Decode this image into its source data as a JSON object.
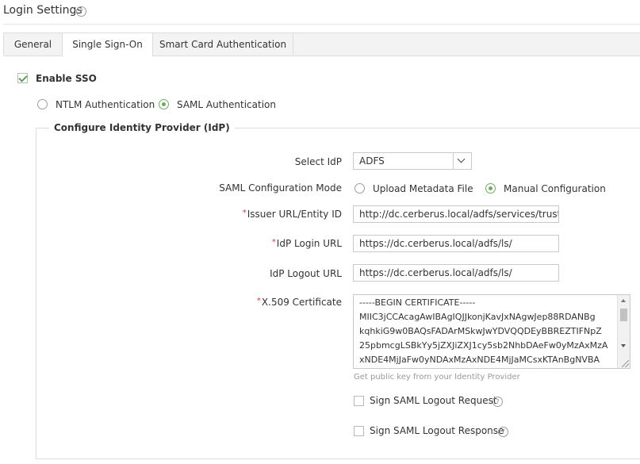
{
  "page": {
    "title": "Login Settings",
    "help_glyph": "?"
  },
  "tabs": [
    {
      "label": "General",
      "active": false
    },
    {
      "label": "Single Sign-On",
      "active": true
    },
    {
      "label": "Smart Card Authentication",
      "active": false
    }
  ],
  "sso": {
    "enable_label": "Enable SSO",
    "enabled": true,
    "auth_options": [
      {
        "label": "NTLM Authentication",
        "selected": false
      },
      {
        "label": "SAML Authentication",
        "selected": true
      }
    ]
  },
  "idp": {
    "section_title": "Configure Identity Provider (IdP)",
    "select_idp": {
      "label": "Select IdP",
      "value": "ADFS"
    },
    "config_mode": {
      "label": "SAML Configuration Mode",
      "options": [
        {
          "label": "Upload Metadata File",
          "selected": false
        },
        {
          "label": "Manual Configuration",
          "selected": true
        }
      ]
    },
    "issuer_url": {
      "label": "Issuer URL/Entity ID",
      "required": true,
      "value": "http://dc.cerberus.local/adfs/services/trust"
    },
    "login_url": {
      "label": "IdP Login URL",
      "required": true,
      "value": "https://dc.cerberus.local/adfs/ls/"
    },
    "logout_url": {
      "label": "IdP Logout URL",
      "required": false,
      "value": "https://dc.cerberus.local/adfs/ls/"
    },
    "certificate": {
      "label": "X.509 Certificate",
      "required": true,
      "lines": [
        "-----BEGIN CERTIFICATE-----",
        "MIIC3jCCAcagAwIBAgIQJJkonjKavJxNAgwJep88RDANBg",
        "kqhkiG9w0BAQsFADArMSkwJwYDVQQDEyBBREZTIFNpZ",
        "25pbmcgLSBkYy5jZXJiZXJ1cy5sb2NhbDAeFw0yMzAxMzA",
        "xNDE4MjJaFw0yNDAxMzAxNDE4MjJaMCsxKTAnBgNVBA"
      ],
      "hint": "Get public key from your Identity Provider"
    },
    "sign_logout_request": {
      "label": "Sign SAML Logout Request",
      "checked": false
    },
    "sign_logout_response": {
      "label": "Sign SAML Logout Response",
      "checked": false
    },
    "required_marker": "*"
  },
  "colors": {
    "accent_green": "#6cae5c",
    "required_red": "#dd3333",
    "border": "#c9c9c9"
  }
}
